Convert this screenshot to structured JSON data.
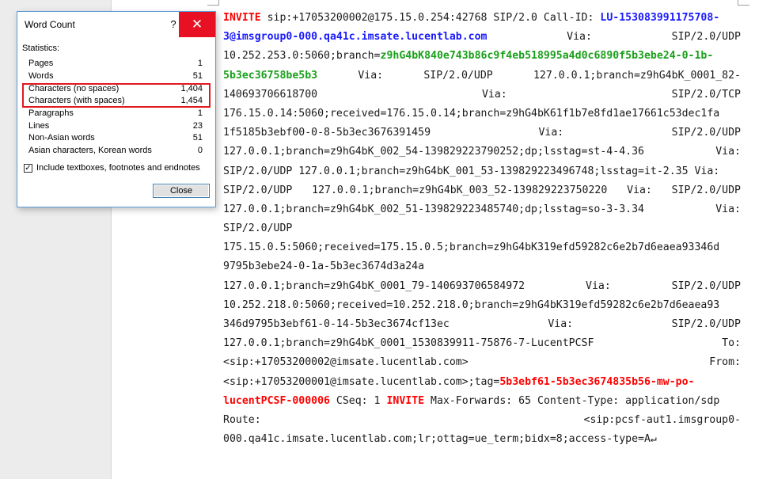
{
  "dialog": {
    "title": "Word Count",
    "help": "?",
    "close_icon": "✕",
    "stats_heading": "Statistics:",
    "stats": [
      {
        "label": "Pages",
        "value": "1"
      },
      {
        "label": "Words",
        "value": "51"
      },
      {
        "label": "Characters (no spaces)",
        "value": "1,404"
      },
      {
        "label": "Characters (with spaces)",
        "value": "1,454"
      },
      {
        "label": "Paragraphs",
        "value": "1"
      },
      {
        "label": "Lines",
        "value": "23"
      },
      {
        "label": "Non-Asian words",
        "value": "51"
      },
      {
        "label": "Asian characters, Korean words",
        "value": "0"
      }
    ],
    "include_checked": true,
    "include_label": "Include textboxes, footnotes and endnotes",
    "close_button": "Close",
    "highlight_color": "#e0191e"
  },
  "document": {
    "colors": {
      "red": "#ff0000",
      "blue": "#1a1aff",
      "green": "#1aa01a"
    },
    "lines": [
      {
        "just": false,
        "parts": [
          {
            "t": "INVITE",
            "c": "red"
          },
          {
            "t": " sip:+17053200002@175.15.0.254:42768 SIP/2.0 Call-ID: "
          },
          {
            "t": "LU-153083991175708-",
            "c": "blue"
          }
        ]
      },
      {
        "just": true,
        "parts": [
          {
            "t": "3@imsgroup0-000.qa41c.imsate.lucentlab.com",
            "c": "blue"
          },
          {
            "t": "Via:"
          },
          {
            "t": "SIP/2.0/UDP"
          }
        ]
      },
      {
        "just": false,
        "parts": [
          {
            "t": "10.252.253.0:5060;branch="
          },
          {
            "t": "z9hG4bK840e743b86c9f4eb518995a4d0c6890f5b3ebe24-0-1b-",
            "c": "green"
          }
        ]
      },
      {
        "just": true,
        "parts": [
          {
            "t": "5b3ec36758be5b3",
            "c": "green"
          },
          {
            "t": "Via:"
          },
          {
            "t": "SIP/2.0/UDP"
          },
          {
            "t": "127.0.0.1;branch=z9hG4bK_0001_82-"
          }
        ]
      },
      {
        "just": true,
        "parts": [
          {
            "t": "140693706618700"
          },
          {
            "t": "Via:"
          },
          {
            "t": "SIP/2.0/TCP"
          }
        ]
      },
      {
        "just": false,
        "parts": [
          {
            "t": "176.15.0.14:5060;received=176.15.0.14;branch=z9hG4bK61f1b7e8fd1ae17661c53dec1fa"
          }
        ]
      },
      {
        "just": true,
        "parts": [
          {
            "t": "1f5185b3ebf00-0-8-5b3ec3676391459"
          },
          {
            "t": "Via:"
          },
          {
            "t": "SIP/2.0/UDP"
          }
        ]
      },
      {
        "just": true,
        "parts": [
          {
            "t": "127.0.0.1;branch=z9hG4bK_002_54-139829223790252;dp;lsstag=st-4-4.36"
          },
          {
            "t": "Via:"
          }
        ]
      },
      {
        "just": false,
        "parts": [
          {
            "t": "SIP/2.0/UDP 127.0.0.1;branch=z9hG4bK_001_53-139829223496748;lsstag=it-2.35 Via:"
          }
        ]
      },
      {
        "just": true,
        "parts": [
          {
            "t": "SIP/2.0/UDP"
          },
          {
            "t": "127.0.0.1;branch=z9hG4bK_003_52-139829223750220"
          },
          {
            "t": "Via:"
          },
          {
            "t": "SIP/2.0/UDP"
          }
        ]
      },
      {
        "just": true,
        "parts": [
          {
            "t": "127.0.0.1;branch=z9hG4bK_002_51-139829223485740;dp;lsstag=so-3-3.34"
          },
          {
            "t": "Via:"
          }
        ]
      },
      {
        "just": false,
        "parts": [
          {
            "t": "SIP/2.0/UDP"
          }
        ]
      },
      {
        "just": false,
        "parts": [
          {
            "t": "175.15.0.5:5060;received=175.15.0.5;branch=z9hG4bK319efd59282c6e2b7d6eaea93346d"
          }
        ]
      },
      {
        "just": false,
        "parts": [
          {
            "t": "9795b3ebe24-0-1a-5b3ec3674d3a24a"
          }
        ]
      },
      {
        "just": true,
        "parts": [
          {
            "t": "127.0.0.1;branch=z9hG4bK_0001_79-140693706584972"
          },
          {
            "t": "Via:"
          },
          {
            "t": "SIP/2.0/UDP"
          }
        ]
      },
      {
        "just": false,
        "parts": [
          {
            "t": "10.252.218.0:5060;received=10.252.218.0;branch=z9hG4bK319efd59282c6e2b7d6eaea93"
          }
        ]
      },
      {
        "just": true,
        "parts": [
          {
            "t": "346d9795b3ebf61-0-14-5b3ec3674cf13ec"
          },
          {
            "t": "Via:"
          },
          {
            "t": "SIP/2.0/UDP"
          }
        ]
      },
      {
        "just": true,
        "parts": [
          {
            "t": "127.0.0.1;branch=z9hG4bK_0001_1530839911-75876-7-LucentPCSF"
          },
          {
            "t": "To:"
          }
        ]
      },
      {
        "just": true,
        "parts": [
          {
            "t": "<sip:+17053200002@imsate.lucentlab.com>"
          },
          {
            "t": "From:"
          }
        ]
      },
      {
        "just": false,
        "parts": [
          {
            "t": "<sip:+17053200001@imsate.lucentlab.com>;tag="
          },
          {
            "t": "5b3ebf61-5b3ec3674835b56-mw-po-",
            "c": "red"
          }
        ]
      },
      {
        "just": false,
        "parts": [
          {
            "t": "lucentPCSF-000006",
            "c": "red"
          },
          {
            "t": " CSeq: 1 "
          },
          {
            "t": "INVITE",
            "c": "red"
          },
          {
            "t": " Max-Forwards: 65 Content-Type: application/sdp"
          }
        ]
      },
      {
        "just": true,
        "parts": [
          {
            "t": "Route:"
          },
          {
            "t": "<sip:pcsf-aut1.imsgroup0-"
          }
        ]
      },
      {
        "just": false,
        "parts": [
          {
            "t": "000.qa41c.imsate.lucentlab.com;lr;ottag=ue_term;bidx=8;access-type=A↵"
          }
        ]
      }
    ]
  }
}
